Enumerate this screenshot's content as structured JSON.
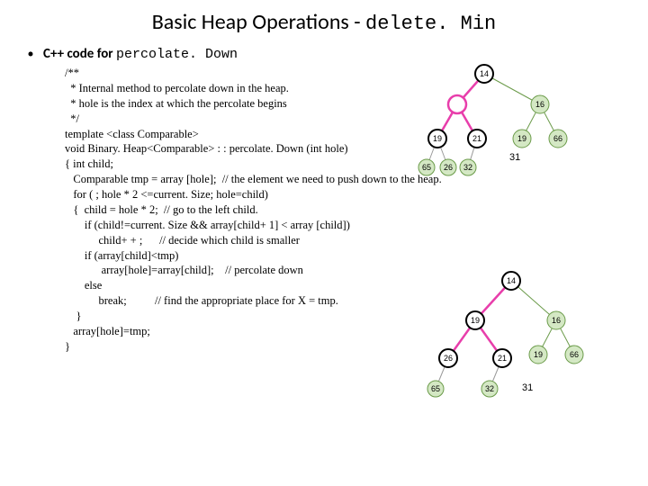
{
  "title_prefix": "Basic Heap Operations - ",
  "title_mono": "delete. Min",
  "subhead_prefix": "C++ code for ",
  "subhead_mono": "percolate. Down",
  "code": "/**\n  * Internal method to percolate down in the heap.\n  * hole is the index at which the percolate begins\n  */\ntemplate <class Comparable>\nvoid Binary. Heap<Comparable> : : percolate. Down (int hole)\n{ int child;\n   Comparable tmp = array [hole];  // the element we need to push down to the heap.\n   for ( ; hole * 2 <=current. Size; hole=child)\n   {  child = hole * 2;  // go to the left child.\n       if (child!=current. Size && array[child+ 1] < array [child])\n            child+ + ;      // decide which child is smaller\n       if (array[child]<tmp)\n             array[hole]=array[child];    // percolate down\n       else\n            break;          // find the appropriate place for X = tmp.\n    }\n   array[hole]=tmp;\n}",
  "tree1": {
    "root": "14",
    "hollow_left": true,
    "level2": [
      "19",
      "21"
    ],
    "floating": "31",
    "sub_right": "16",
    "sub_right_children": [
      "19",
      "66"
    ],
    "sub_left_children": [
      "65",
      "26",
      "32"
    ]
  },
  "tree2": {
    "root": "14",
    "level2_left": "19",
    "sub_right": "16",
    "sub_right_children": [
      "19",
      "66"
    ],
    "level3": [
      "26",
      "21"
    ],
    "floating": "31",
    "sub_left_grandchild": [
      "65",
      "32"
    ]
  }
}
